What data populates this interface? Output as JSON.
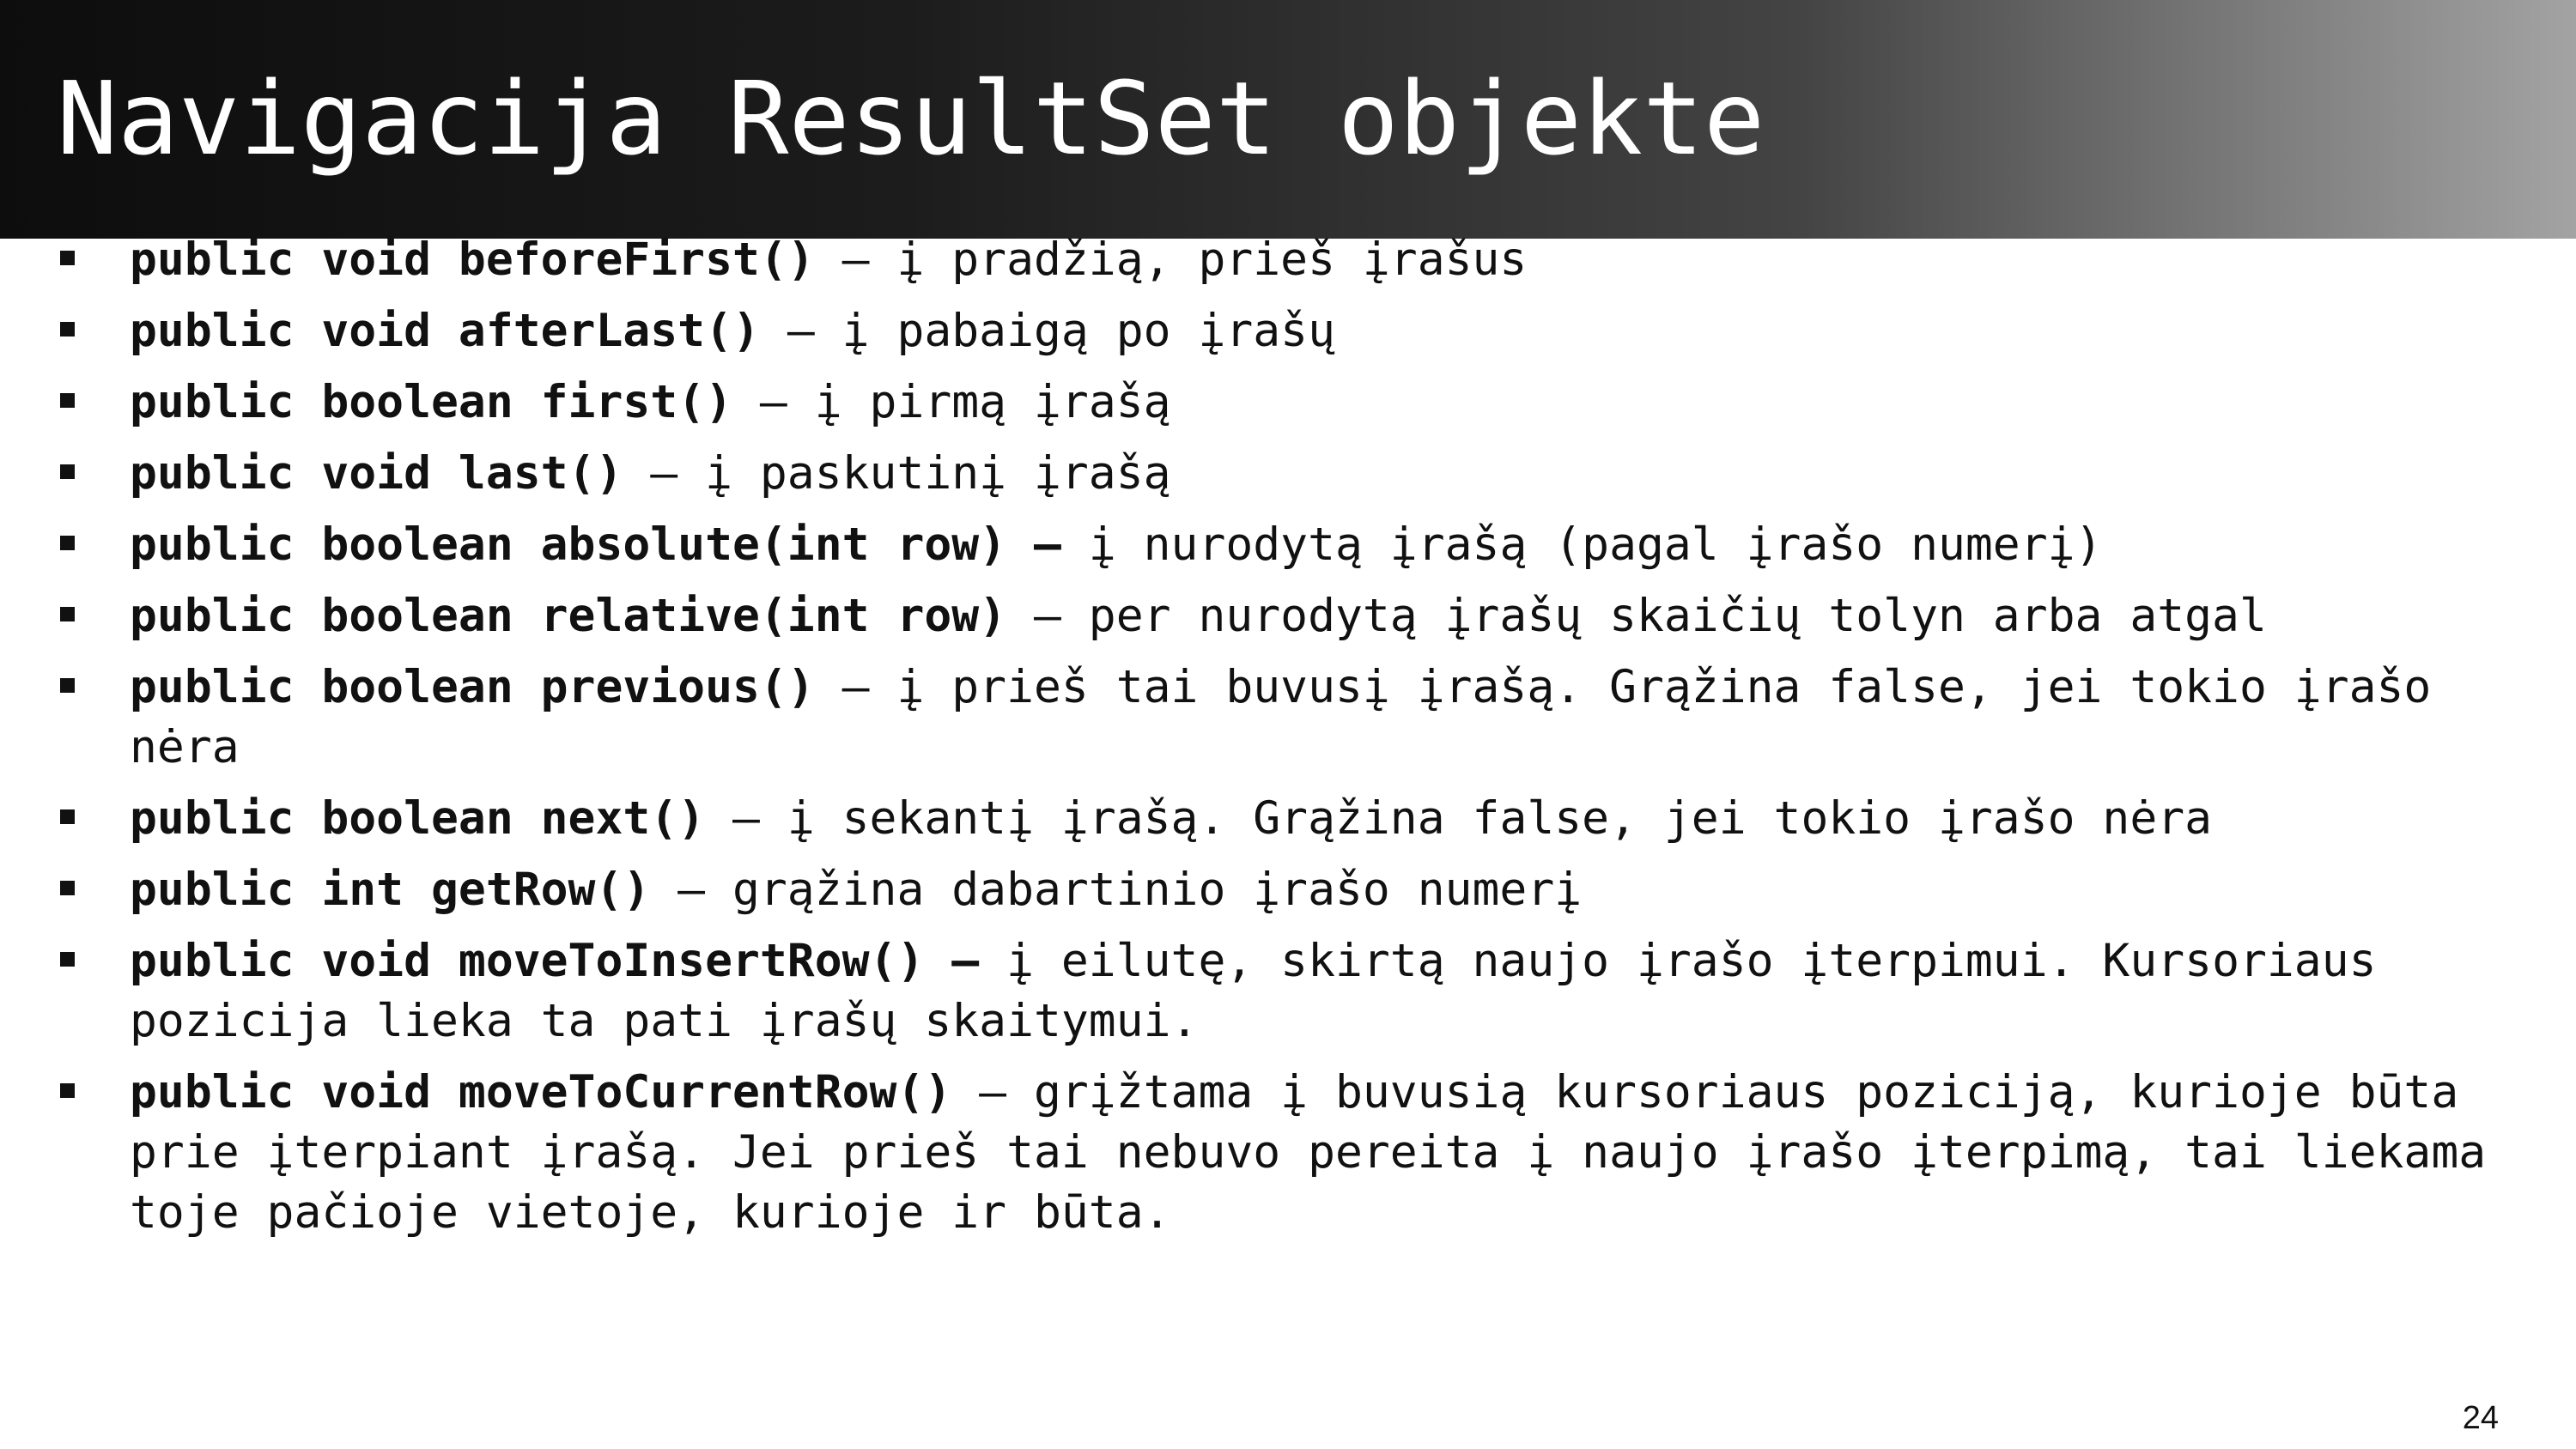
{
  "slide": {
    "title": "Navigacija ResultSet objekte",
    "page_number": "24",
    "colors": {
      "title_bar_left": "#0d0d0d",
      "title_bar_right": "#a3a3a3",
      "title_text": "#ffffff",
      "body_text": "#111111"
    },
    "items": [
      {
        "code": "public void beforeFirst()",
        "desc": " – į pradžią, prieš įrašus"
      },
      {
        "code": "public void afterLast()",
        "desc": " – į pabaigą po įrašų"
      },
      {
        "code": "public boolean first()",
        "desc": " – į pirmą įrašą"
      },
      {
        "code": "public void last()",
        "desc": " – į paskutinį įrašą"
      },
      {
        "code": "public boolean absolute(int row) –",
        "desc": " į nurodytą įrašą (pagal įrašo numerį)"
      },
      {
        "code": "public boolean relative(int row)",
        "desc": " – per nurodytą įrašų skaičių tolyn arba atgal"
      },
      {
        "code": "public boolean previous()",
        "desc": " – į prieš tai buvusį įrašą. Grąžina false, jei tokio įrašo nėra"
      },
      {
        "code": "public boolean next()",
        "desc": " – į sekantį įrašą. Grąžina false, jei tokio įrašo nėra"
      },
      {
        "code": "public int getRow()",
        "desc": " – grąžina dabartinio įrašo numerį"
      },
      {
        "code": "public void moveToInsertRow() –",
        "desc": " į eilutę, skirtą naujo įrašo įterpimui. Kursoriaus pozicija lieka ta pati įrašų skaitymui."
      },
      {
        "code": "public void moveToCurrentRow()",
        "desc": " – grįžtama į buvusią kursoriaus poziciją, kurioje būta prie įterpiant įrašą. Jei prieš tai nebuvo pereita į naujo įrašo įterpimą, tai liekama toje pačioje vietoje, kurioje ir būta."
      }
    ]
  }
}
